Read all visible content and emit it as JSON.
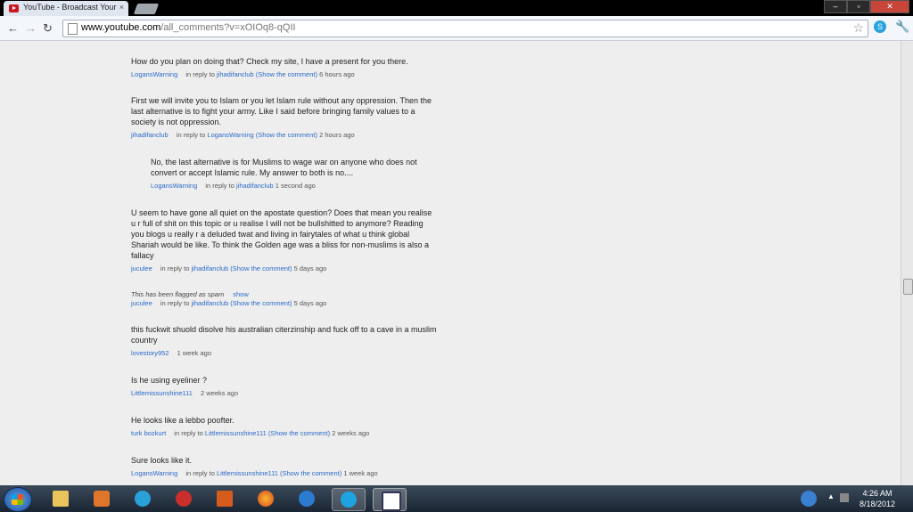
{
  "browser": {
    "tab_title": "YouTube - Broadcast Your",
    "tab_close": "×",
    "window_buttons": {
      "minimize": "–",
      "maximize": "▫",
      "close": "✕"
    },
    "url_domain": "www.youtube.com",
    "url_path": "/all_comments?v=xOIOq8-qQII"
  },
  "comments": [
    {
      "text": "How do you plan on doing that? Check my site, I have a present for you there.",
      "author": "LogansWarning",
      "reply_prefix": "in reply to",
      "reply_to": "jihadifanclub",
      "show_link": "(Show the comment)",
      "time": "6 hours ago"
    },
    {
      "text": "First we will invite you to Islam or you let Islam rule without any oppression. Then the last alternative is to fight your army. Like I said before bringing family values to a society is not oppression.",
      "author": "jihadifanclub",
      "reply_prefix": "in reply to",
      "reply_to": "LogansWarning",
      "show_link": "(Show the comment)",
      "time": "2 hours ago"
    },
    {
      "text": "No, the last alternative is for Muslims to wage war on anyone who does not convert or accept Islamic rule. My answer to both is no....",
      "author": "LogansWarning",
      "reply_prefix": "in reply to",
      "reply_to": "jihadifanclub",
      "show_link": "",
      "time": "1 second ago"
    },
    {
      "text": "U seem to have gone all quiet on the apostate question? Does that mean you realise u r full of shit on this topic or u realise I will not be bullshitted to anymore? Reading you blogs u really r a deluded twat and living in fairytales of what u think global Shariah would be like. To think the Golden age was a bliss for non-muslims is also a fallacy",
      "author": "juculee",
      "reply_prefix": "in reply to",
      "reply_to": "jihadifanclub",
      "show_link": "(Show the comment)",
      "time": "5 days ago"
    },
    {
      "flag_text": "This has been flagged as spam",
      "show_label": "show",
      "author": "juculee",
      "reply_prefix": "in reply to",
      "reply_to": "jihadifanclub",
      "show_link": "(Show the comment)",
      "time": "5 days ago"
    },
    {
      "text": "this fuckwit shuold disolve his australian citerzinship and fuck off to a cave in a muslim country",
      "author": "lovestory952",
      "time": "1 week ago"
    },
    {
      "text": "Is he using eyeliner ?",
      "author": "Littlemissunshine111",
      "time": "2 weeks ago"
    },
    {
      "text": "He looks like a lebbo poofter.",
      "author": "turk bozkurt",
      "reply_prefix": "in reply to",
      "reply_to": "Littlemissunshine111",
      "show_link": "(Show the comment)",
      "time": "2 weeks ago"
    },
    {
      "text": "Sure looks like it.",
      "author": "LogansWarning",
      "reply_prefix": "in reply to",
      "reply_to": "Littlemissunshine111",
      "show_link": "(Show the comment)",
      "time": "1 week ago"
    }
  ],
  "taskbar": {
    "clock_time": "4:26 AM",
    "clock_date": "8/18/2012",
    "tray_arrow": "▲"
  },
  "colors": {
    "link": "#2a6ac8",
    "text": "#222222",
    "background": "#eeeeee"
  }
}
